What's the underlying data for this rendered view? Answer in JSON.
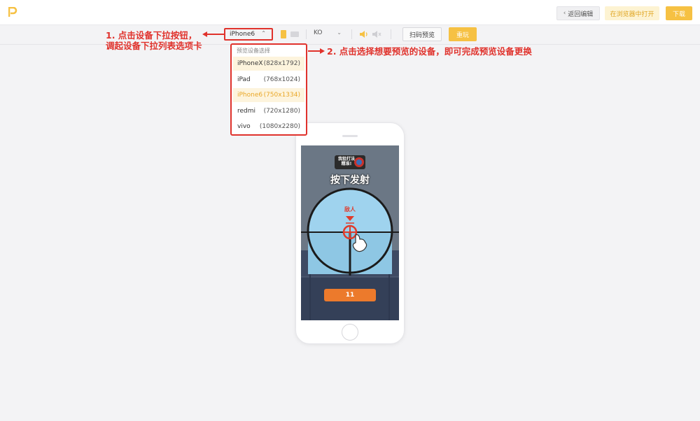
{
  "header": {
    "logo_icon": "p-logo-icon",
    "back_label": "返回编辑",
    "open_in_browser_label": "在浏览器中打开",
    "download_label": "下载"
  },
  "toolbar": {
    "device_value": "iPhone6",
    "language_value": "KO",
    "scan_preview_label": "扫码预览",
    "replay_label": "重玩",
    "orientation_portrait_icon": "portrait-icon",
    "orientation_landscape_icon": "landscape-icon",
    "volume_on_icon": "volume-on-icon",
    "volume_off_icon": "volume-off-icon"
  },
  "annotations": {
    "step1_line1": "1. 点击设备下拉按钮，",
    "step1_line2": "调起设备下拉列表选项卡",
    "step2": "2. 点击选择想要预览的设备，即可完成预览设备更换"
  },
  "device_dropdown": {
    "title": "预览设备选择",
    "items": [
      {
        "name": "iPhoneX",
        "resolution": "(828x1792)"
      },
      {
        "name": "iPad",
        "resolution": "(768x1024)"
      },
      {
        "name": "iPhone6",
        "resolution": "(750x1334)"
      },
      {
        "name": "redmi",
        "resolution": "(720x1280)"
      },
      {
        "name": "vivo",
        "resolution": "(1080x2280)"
      }
    ]
  },
  "game": {
    "badge_line1": "我狙打法",
    "badge_line2": "精准!",
    "instruction": "按下发射",
    "enemy_label": "敌人",
    "counter": "11"
  },
  "colors": {
    "accent": "#f6c143",
    "annotation_red": "#e0322c",
    "active_text": "#e9a727"
  }
}
